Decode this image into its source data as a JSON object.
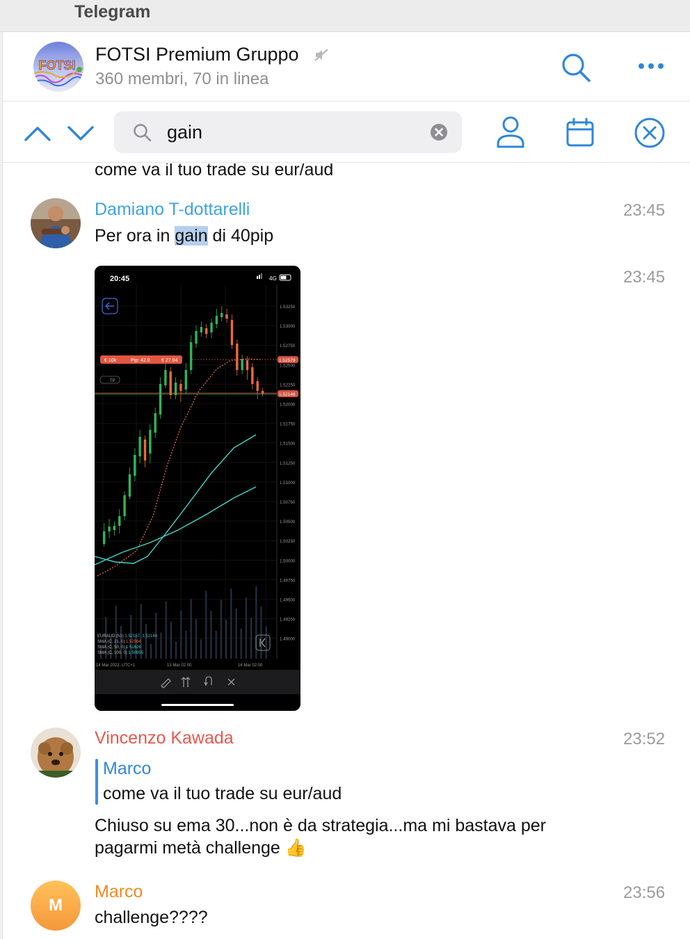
{
  "app": {
    "title": "Telegram"
  },
  "chat": {
    "name": "FOTSI Premium Gruppo",
    "subtitle": "360 membri, 70 in linea",
    "avatar_text": "FOTSI"
  },
  "search": {
    "query": "gain"
  },
  "icons": {
    "mute": "muted-speaker-icon",
    "search": "search-icon",
    "more": "more-dots-icon",
    "up": "chevron-up-icon",
    "down": "chevron-down-icon",
    "clear": "clear-circle-icon",
    "user": "user-icon",
    "calendar": "calendar-icon",
    "close": "close-circle-icon"
  },
  "colors": {
    "accent": "#2f86d8",
    "highlight": "#b6cff0",
    "damiano": "#3fa2e6",
    "vincenzo": "#e8574e",
    "marco": "#f08a24"
  },
  "messages": {
    "top_partial": "come va il tuo trade su eur/aud",
    "m1": {
      "sender": "Damiano T-dottarelli",
      "time": "23:45",
      "pre": "Per ora in ",
      "match": "gain",
      "post": " di 40pip"
    },
    "m2": {
      "time": "23:45"
    },
    "m3": {
      "sender": "Vincenzo Kawada",
      "time": "23:52",
      "reply_to": "Marco",
      "reply_text": "come va il tuo trade su eur/aud",
      "line1": "Chiuso su ema 30...non è da strategia...ma mi bastava per",
      "line2": "pagarmi metà challenge 👍"
    },
    "m4": {
      "sender": "Marco",
      "initial": "M",
      "time": "23:56",
      "text": "challenge????"
    }
  },
  "screenshot": {
    "status_time": "20:45",
    "network": "4G",
    "symbol": "EURAUD (h1)",
    "order_qty": "€ 10k",
    "pips": "Pip: 42.0",
    "profit": "€ 27.04",
    "tp": "TP",
    "price_labels": [
      "1.53250",
      "1.53000",
      "1.52750",
      "1.52500",
      "1.52250",
      "1.52000",
      "1.51750",
      "1.51500",
      "1.51250",
      "1.51000",
      "1.50750",
      "1.50500",
      "1.50250",
      "1.50000",
      "1.49750",
      "1.49500",
      "1.49250",
      "1.49000"
    ],
    "marker_high": "1.52579",
    "marker_low": "1.52146",
    "dates": [
      "14 Mar 2022, UTC+1",
      "15 Mar 02:00",
      "16 Mar 02:00"
    ],
    "legend": [
      {
        "label": "EURAUD (h1)",
        "value": "1.52157, 1.52146"
      },
      {
        "label": "SMA (C, 21, 0)",
        "value": "1.52564"
      },
      {
        "label": "SMA (C, 50, 0)",
        "value": "1.51626"
      },
      {
        "label": "SMA (C, 100, 0)",
        "value": "1.50955"
      }
    ]
  }
}
